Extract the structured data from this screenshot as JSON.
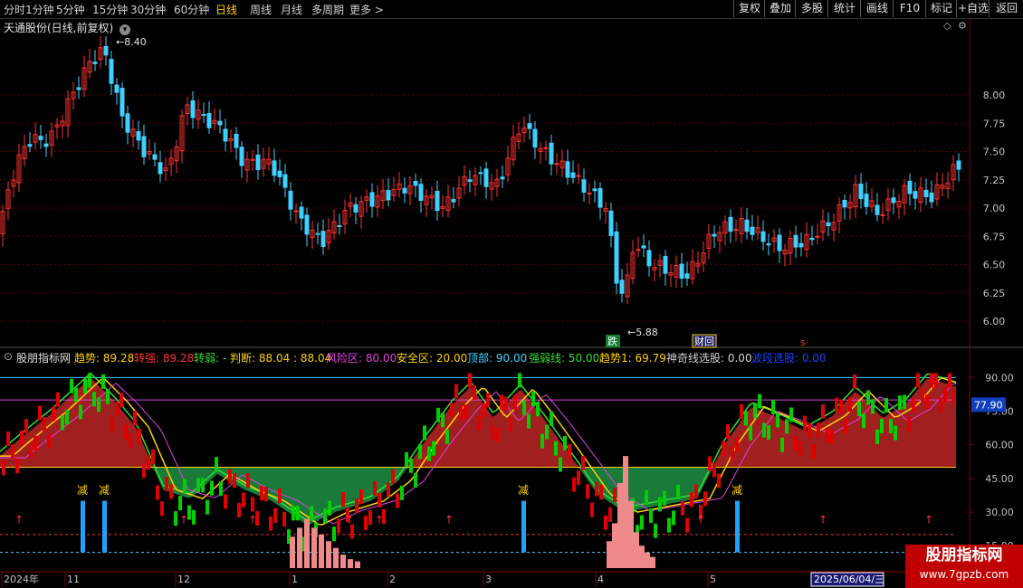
{
  "toolbar": {
    "periods": [
      "分时",
      "1分钟",
      "5分钟",
      "15分钟",
      "30分钟",
      "60分钟",
      "日线",
      "周线",
      "月线",
      "多周期",
      "更多 >"
    ],
    "active_period": "日线",
    "buttons": [
      "复权",
      "叠加",
      "多股",
      "统计",
      "画线",
      "F10",
      "标记",
      "+自选",
      "返回"
    ]
  },
  "chart_title": "天通股份(日线,前复权)",
  "price_axis": [
    "8.00",
    "7.75",
    "7.50",
    "7.25",
    "7.00",
    "6.75",
    "6.50",
    "6.25",
    "6.00"
  ],
  "price_high_label": "8.40",
  "price_low_label": "5.88",
  "event_markers": {
    "die": "跌",
    "caihui": "财回",
    "s": "s"
  },
  "indicator": {
    "name": "股朋指标网",
    "items": [
      {
        "label": "趋势: 89.28",
        "color": "#ffd000"
      },
      {
        "label": "转强: 89.28",
        "color": "#ff3030"
      },
      {
        "label": "转弱: -",
        "color": "#30e030"
      },
      {
        "label": "判断: 88.04 : 88.04",
        "color": "#ffd000"
      },
      {
        "label": "风险区: 80.00",
        "color": "#e040e0"
      },
      {
        "label": "安全区: 20.00",
        "color": "#ffd000"
      },
      {
        "label": "顶部: 90.00",
        "color": "#40d0ff"
      },
      {
        "label": "强弱线: 50.00",
        "color": "#30e030"
      },
      {
        "label": "趋势1: 69.79",
        "color": "#ffd000"
      },
      {
        "label": "神奇线选股: 0.00",
        "color": "#d0d0d0"
      },
      {
        "label": "波段选股: 0.00",
        "color": "#2040ff"
      }
    ]
  },
  "indicator_axis": [
    "90.00",
    "75.00",
    "60.00",
    "45.00",
    "30.00",
    "15.00"
  ],
  "indicator_current_value": "77.90",
  "jian_label": "减",
  "date_axis": [
    "2024年",
    "11",
    "12",
    "1",
    "2",
    "3",
    "4",
    "5"
  ],
  "date_cursor": "2025/06/04/三",
  "colors": {
    "up": "#ff3030",
    "down": "#40d0ff",
    "indicator_up": "#e00000",
    "indicator_down": "#00d000",
    "cloud_red": "#a02020",
    "cloud_green": "#1a7a3a"
  },
  "watermark": {
    "title": "股朋指标网",
    "url": "www.7gpzb.com"
  }
}
